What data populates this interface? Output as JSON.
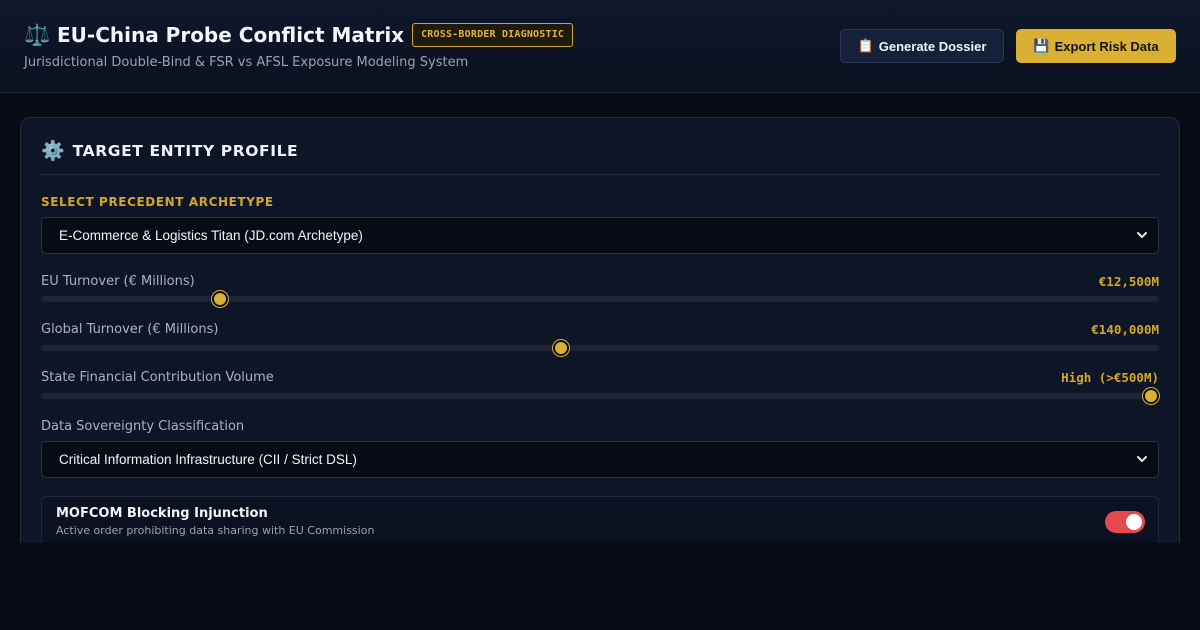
{
  "header": {
    "title_icon": "balance-scale-icon",
    "title_glyph": "⚖️",
    "title": "EU-China Probe Conflict Matrix",
    "badge": "CROSS-BORDER DIAGNOSTIC",
    "subtitle": "Jurisdictional Double-Bind & FSR vs AFSL Exposure Modeling System",
    "buttons": [
      {
        "label": "Generate Dossier",
        "icon": "clipboard-icon",
        "glyph": "📋"
      },
      {
        "label": "Export Risk Data",
        "icon": "floppy-disk-icon",
        "glyph": "💾"
      }
    ]
  },
  "profile": {
    "icon": "gear-icon",
    "icon_glyph": "⚙️",
    "title": "TARGET ENTITY PROFILE",
    "archetype_label": "SELECT PRECEDENT ARCHETYPE",
    "archetype_value": "E-Commerce & Logistics Titan (JD.com Archetype)",
    "sliders": [
      {
        "label": "EU Turnover (€ Millions)",
        "value_text": "€12,500M",
        "fraction": 0.16
      },
      {
        "label": "Global Turnover (€ Millions)",
        "value_text": "€140,000M",
        "fraction": 0.465
      },
      {
        "label": "State Financial Contribution Volume",
        "value_text": "High (>€500M)",
        "fraction": 0.993
      }
    ],
    "data_sovereignty_label": "Data Sovereignty Classification",
    "data_sovereignty_value": "Critical Information Infrastructure (CII / Strict DSL)",
    "injunction": {
      "title": "MOFCOM Blocking Injunction",
      "description": "Active order prohibiting data sharing with EU Commission",
      "enabled": true
    }
  },
  "colors": {
    "accent_gold": "#d9b034",
    "toggle_on": "#e5484d",
    "background": "#070b14"
  }
}
